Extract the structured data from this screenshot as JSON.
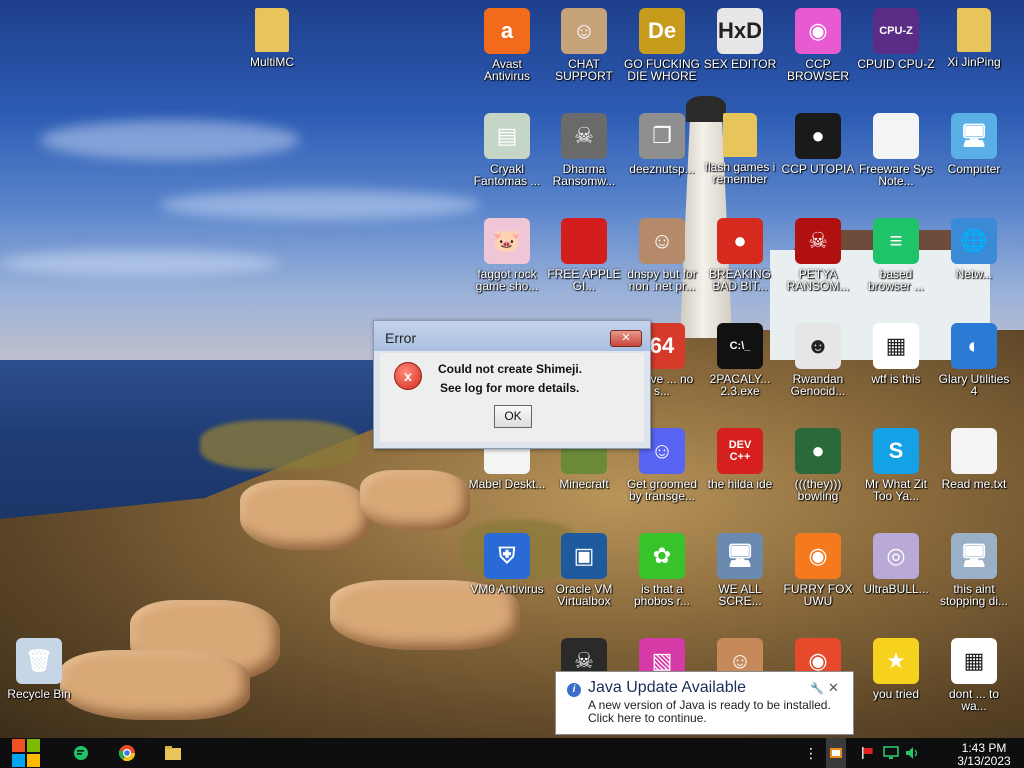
{
  "desktop_icons": [
    {
      "label": "MultiMC",
      "icon": "folder-icon",
      "glyph": "",
      "color": "#e8c55a"
    },
    {
      "label": "Avast Antivirus",
      "icon": "avast-icon",
      "glyph": "a",
      "color": "#f26b1d"
    },
    {
      "label": "CHAT SUPPORT",
      "icon": "doctor-icon",
      "glyph": "☺",
      "color": "#c7a37b"
    },
    {
      "label": "GO FUCKING DIE WHORE",
      "icon": "de-logo-icon",
      "glyph": "De",
      "color": "#c79b1b"
    },
    {
      "label": "SEX EDITOR",
      "icon": "hxd-icon",
      "glyph": "HxD",
      "color": "#e7e7e7"
    },
    {
      "label": "CCP BROWSER",
      "icon": "browser-swirl-icon",
      "glyph": "◉",
      "color": "#e85ad2"
    },
    {
      "label": "CPUID CPU-Z",
      "icon": "cpuz-icon",
      "glyph": "CPU-Z",
      "color": "#5a2c86"
    },
    {
      "label": "Xi JinPing",
      "icon": "user-folder-icon",
      "glyph": "",
      "color": "#e8c55a"
    },
    {
      "label": "Cryakl Fantomas ...",
      "icon": "window-app-icon",
      "glyph": "▤",
      "color": "#c6d6c6"
    },
    {
      "label": "Dharma Ransomw...",
      "icon": "skull-icon",
      "glyph": "☠",
      "color": "#6a6a6a"
    },
    {
      "label": "deeznutsp...",
      "icon": "stacked-windows-icon",
      "glyph": "❐",
      "color": "#8f8f8f"
    },
    {
      "label": "flash games i remember",
      "icon": "folder-icon",
      "glyph": "",
      "color": "#e8c55a"
    },
    {
      "label": "CCP UTOPIA",
      "icon": "dark-circle-icon",
      "glyph": "●",
      "color": "#1a1a1a"
    },
    {
      "label": "Freeware Sys Note...",
      "icon": "document-icon",
      "glyph": "",
      "color": "#f4f4f4"
    },
    {
      "label": "Computer",
      "icon": "computer-icon",
      "glyph": "🖥",
      "color": "#5ab0e6"
    },
    {
      "label": "faggot rock game sho...",
      "icon": "pig-icon",
      "glyph": "🐷",
      "color": "#f0c6d6"
    },
    {
      "label": "FREE APPLE GI...",
      "icon": "apple-icon",
      "glyph": "",
      "color": "#d41e1e"
    },
    {
      "label": "dnspy but for non .net pr...",
      "icon": "portrait-icon",
      "glyph": "☺",
      "color": "#b48a6a"
    },
    {
      "label": "BREAKING BAD BIT...",
      "icon": "angry-bird-icon",
      "glyph": "●",
      "color": "#d62a1e"
    },
    {
      "label": "PETYA RANSOM...",
      "icon": "red-skull-icon",
      "glyph": "☠",
      "color": "#b01010"
    },
    {
      "label": "based browser ...",
      "icon": "chat-bubble-icon",
      "glyph": "≡",
      "color": "#1ec46a"
    },
    {
      "label": "Netw...",
      "icon": "network-icon",
      "glyph": "🌐",
      "color": "#3a8ad6"
    },
    {
      "label": "above ... no s...",
      "icon": "red-text-icon",
      "glyph": "64",
      "color": "#d63a2a"
    },
    {
      "label": "2PACALY... 2.3.exe",
      "icon": "cmd-icon",
      "glyph": "C:\\_",
      "color": "#111111"
    },
    {
      "label": "Rwandan Genocid...",
      "icon": "meme-face-icon",
      "glyph": "☻",
      "color": "#e6e6e6"
    },
    {
      "label": "wtf is this",
      "icon": "calendar-icon",
      "glyph": "▦",
      "color": "#ffffff"
    },
    {
      "label": "Glary Utilities 4",
      "icon": "glary-icon",
      "glyph": "◐",
      "color": "#2a7ad6"
    },
    {
      "label": "Mabel Deskt...",
      "icon": "document-icon",
      "glyph": "",
      "color": "#f4f4f4"
    },
    {
      "label": "Minecraft",
      "icon": "minecraft-icon",
      "glyph": "",
      "color": "#6a8a3a"
    },
    {
      "label": "Get groomed by transge...",
      "icon": "discord-icon",
      "glyph": "☺",
      "color": "#5865f2"
    },
    {
      "label": "the hilda ide",
      "icon": "devcpp-icon",
      "glyph": "DEV C++",
      "color": "#d6201e"
    },
    {
      "label": "(((they))) bowling",
      "icon": "bowling-icon",
      "glyph": "●",
      "color": "#2a6a3a"
    },
    {
      "label": "Mr What Zit Too Ya...",
      "icon": "skype-icon",
      "glyph": "S",
      "color": "#14a1e6"
    },
    {
      "label": "Read me.txt",
      "icon": "text-file-icon",
      "glyph": "",
      "color": "#f4f4f4"
    },
    {
      "label": "VM0 Antivirus",
      "icon": "shield-icon",
      "glyph": "⛨",
      "color": "#2a6ad6"
    },
    {
      "label": "Oracle VM Virtualbox",
      "icon": "virtualbox-icon",
      "glyph": "▣",
      "color": "#1e5a9e"
    },
    {
      "label": "is that a phobos r...",
      "icon": "icq-icon",
      "glyph": "✿",
      "color": "#37c42a"
    },
    {
      "label": "WE ALL SCRE...",
      "icon": "computer-icon",
      "glyph": "🖥",
      "color": "#6a8ab0"
    },
    {
      "label": "FURRY FOX UWU",
      "icon": "firefox-icon",
      "glyph": "◉",
      "color": "#f57a1e"
    },
    {
      "label": "UltraBULL...",
      "icon": "cd-icon",
      "glyph": "◎",
      "color": "#b8a9d6"
    },
    {
      "label": "this aint stopping di...",
      "icon": "computer-icon",
      "glyph": "🖥",
      "color": "#9ab0c6"
    },
    {
      "label": "Recycle Bin",
      "icon": "recycle-bin-icon",
      "glyph": "🗑",
      "color": "#c6d6e6"
    },
    {
      "label": "",
      "icon": "skull-icon",
      "glyph": "☠",
      "color": "#2a2a2a"
    },
    {
      "label": "",
      "icon": "image-icon",
      "glyph": "▧",
      "color": "#d63aa6"
    },
    {
      "label": "",
      "icon": "cartoon-face-icon",
      "glyph": "☺",
      "color": "#c68a5a"
    },
    {
      "label": "",
      "icon": "chrome-icon",
      "glyph": "◉",
      "color": "#e64a2a"
    },
    {
      "label": "you tried",
      "icon": "star-icon",
      "glyph": "★",
      "color": "#f6d21e"
    },
    {
      "label": "dont ... to wa...",
      "icon": "calendar-icon",
      "glyph": "▦",
      "color": "#ffffff"
    }
  ],
  "error_dialog": {
    "title": "Error",
    "close_glyph": "✕",
    "icon_glyph": "x",
    "line1": "Could not create Shimeji.",
    "line2": "See log for more details.",
    "ok_label": "OK"
  },
  "java_notification": {
    "title": "Java Update Available",
    "line1": "A new version of Java is ready to be installed.",
    "line2": "Click here to continue.",
    "info_glyph": "i",
    "pin_glyph": "🔧",
    "close_glyph": "✕"
  },
  "taskbar": {
    "apps": [
      {
        "name": "start",
        "icon": "windows-logo-icon"
      },
      {
        "name": "chat",
        "icon": "chat-bubble-icon",
        "color": "#1ec46a"
      },
      {
        "name": "chrome",
        "icon": "chrome-icon",
        "color": "#e64a2a"
      },
      {
        "name": "explorer",
        "icon": "folder-icon",
        "color": "#e8c55a"
      }
    ],
    "tray": {
      "overflow_glyph": "⋮",
      "java_icon": "java-update-icon",
      "flag_icon": "flag-icon",
      "network_icon": "network-monitor-icon",
      "volume_icon": "volume-icon"
    },
    "clock_time": "1:43 PM",
    "clock_date": "3/13/2023"
  },
  "colors": {
    "taskbar_bg": "#0e0e10",
    "win_red": "#f25022",
    "win_green": "#7fba00",
    "win_blue": "#00a4ef",
    "win_yellow": "#ffb900"
  }
}
